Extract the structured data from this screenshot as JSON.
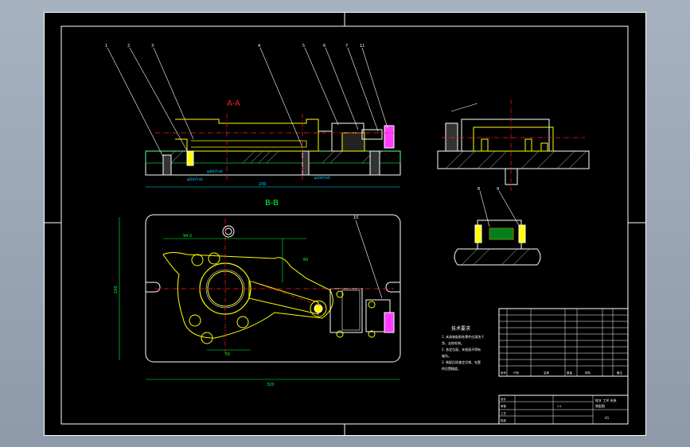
{
  "colors": {
    "background_outer": "#9aa6b4",
    "canvas": "#000000",
    "line_white": "#ffffff",
    "line_yellow": "#ffff00",
    "line_red": "#ff2020",
    "line_cyan": "#00e5ff",
    "line_green": "#00ff3a",
    "line_magenta": "#ff3cff"
  },
  "section_labels": {
    "aa": "A-A",
    "bb": "B-B"
  },
  "balloons": [
    "1",
    "2",
    "3",
    "4",
    "5",
    "6",
    "7",
    "11"
  ],
  "balloons_lower": [
    "8",
    "9",
    "10"
  ],
  "dims": {
    "d1": "φ40H7/n6",
    "d2": "φ20H7/n6",
    "d3": "φ10H7/n6",
    "d4": "94.5",
    "d5": "60",
    "d6": "55",
    "d7": "320",
    "d8": "230",
    "d9": "100"
  },
  "tech_req": {
    "title": "技术要求",
    "lines": [
      "1. 夹具装配前各零件应清洗干",
      "净，去除毛刺。",
      "2. 各定位面、夹紧面不得有",
      "碰伤。",
      "3. 装配后检查定位销、钻套",
      "的位置精度。"
    ]
  },
  "title_block": {
    "name_line1": "拨叉 工序 夹具",
    "name_line2": "装配图",
    "scale": "1:1",
    "sheet": "A1",
    "cells": [
      "序号",
      "代号",
      "名称",
      "数量",
      "材料",
      "备注",
      "设计",
      "审核",
      "工艺",
      "批准"
    ]
  }
}
